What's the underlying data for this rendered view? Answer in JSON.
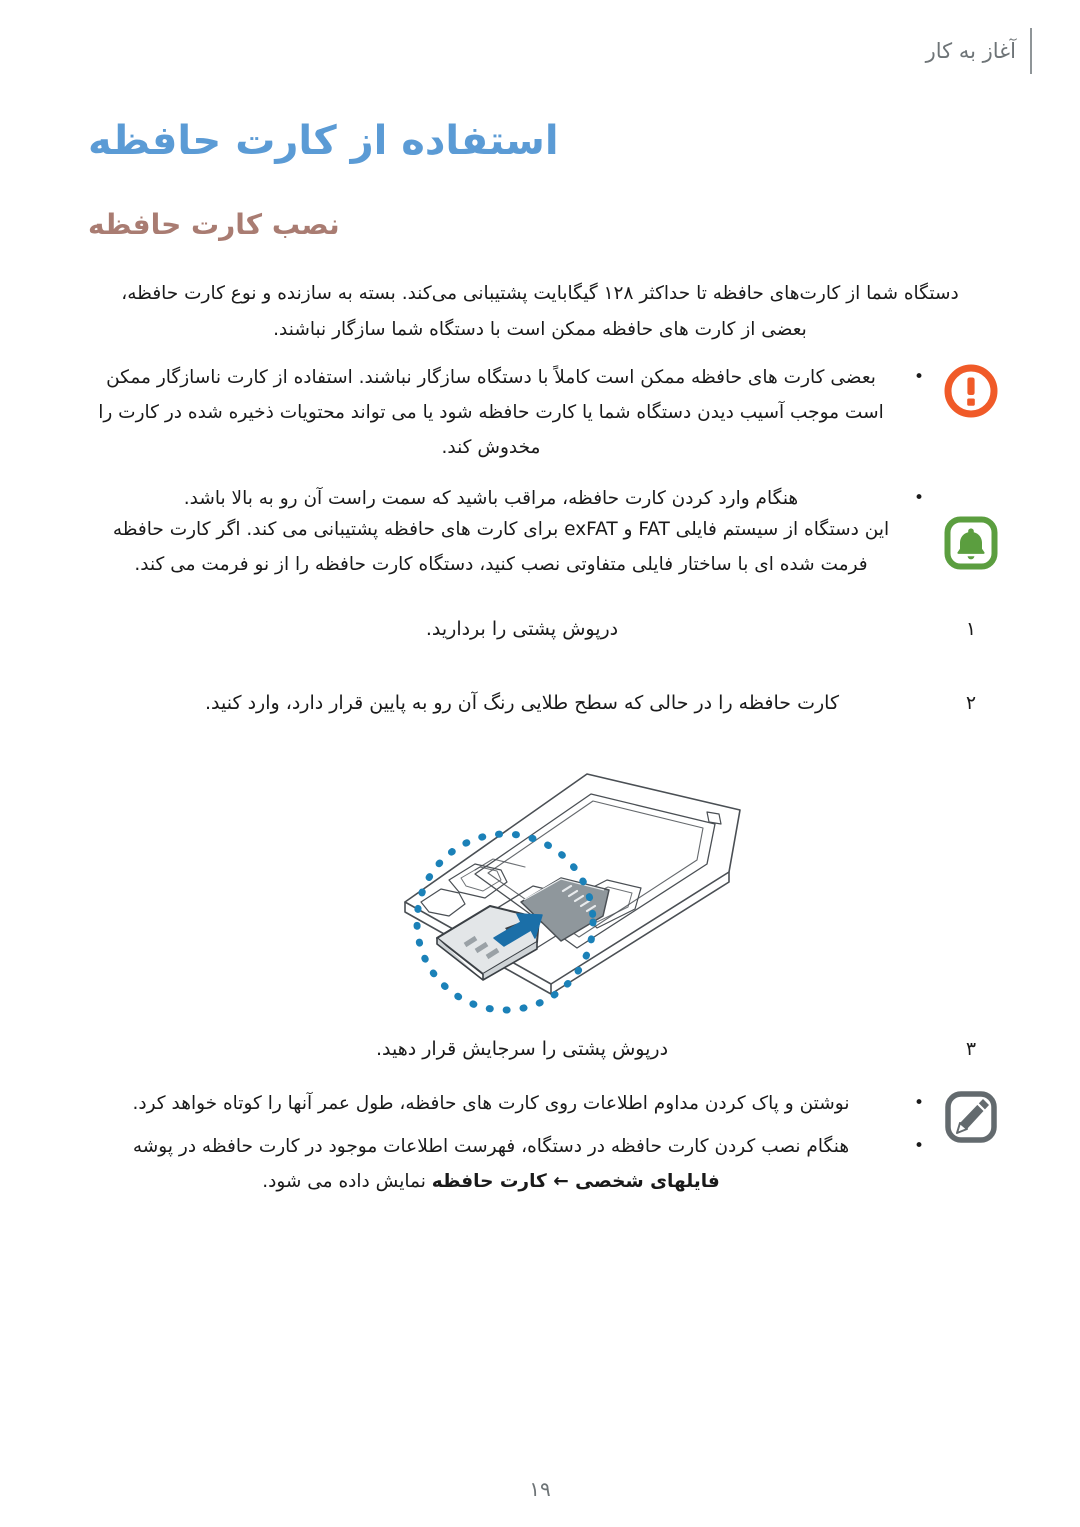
{
  "header": {
    "chapter_label": "آغاز به کار"
  },
  "titles": {
    "chapter": "استفاده از کارت حافظه",
    "section": "نصب کارت حافظه"
  },
  "intro": {
    "line1": "دستگاه شما از کارت‌های حافظه تا حداکثر ۱۲۸ گیگابایت پشتیبانی می‌کند. بسته به سازنده و نوع کارت حافظه،",
    "line2": "بعضی از کارت های حافظه ممکن است با دستگاه شما سازگار نباشند."
  },
  "callouts": [
    {
      "id": "warning",
      "icon": "warning-exclamation-icon",
      "icon_color": "#f05a28",
      "bullets": [
        {
          "lines": [
            "بعضی کارت های حافظه ممکن است کاملاً با دستگاه سازگار نباشند. استفاده از کارت ناسازگار ممکن",
            "است موجب آسیب دیدن دستگاه شما یا کارت حافظه شود یا می تواند محتویات ذخیره شده در کارت را",
            "مخدوش کند."
          ]
        },
        {
          "lines": [
            "هنگام وارد کردن کارت حافظه، مراقب باشید که سمت راست آن رو به بالا باشد."
          ]
        }
      ]
    },
    {
      "id": "note",
      "icon": "bell-icon",
      "icon_color": "#5b9e3f",
      "bullets": [
        {
          "lines": [
            "این دستگاه از سیستم فایلی FAT و exFAT برای کارت های حافظه پشتیبانی می کند. اگر کارت حافظه",
            "فرمت شده ای با ساختار فایلی متفاوتی نصب کنید، دستگاه کارت حافظه را از نو فرمت می کند."
          ]
        }
      ]
    },
    {
      "id": "tip",
      "icon": "pencil-note-icon",
      "icon_color": "#636a6e",
      "bullets": [
        {
          "lines": [
            "نوشتن و پاک کردن مداوم اطلاعات روی کارت های حافظه، طول عمر آنها را کوتاه خواهد کرد."
          ]
        },
        {
          "lines": [
            "هنگام نصب کردن کارت حافظه در دستگاه، فهرست اطلاعات موجود در کارت حافظه در پوشه"
          ],
          "line_bold_prefix": "فایلهای شخصی ← کارت حافظه",
          "line_bold_suffix": " نمایش داده می شود."
        }
      ]
    }
  ],
  "steps": [
    {
      "number": "۱",
      "text": "درپوش پشتی را بردارید."
    },
    {
      "number": "۲",
      "text": "کارت حافظه را در حالی که سطح طلایی رنگ آن رو به پایین قرار دارد، وارد کنید."
    },
    {
      "number": "۳",
      "text": "درپوش پشتی را سرجایش قرار دهید."
    }
  ],
  "illustration": {
    "name": "memory-card-insertion-diagram",
    "highlight_circle_color": "#1b81b8",
    "arrow_color": "#1b6fa8",
    "card_fill": "#8f979c",
    "outline_color": "#4a4f54"
  },
  "footer": {
    "page_number": "۱۹"
  },
  "colors": {
    "chapter_title": "#5b9bd5",
    "section_title": "#a97c72",
    "header_text": "#6e7477",
    "body_text": "#1a1a1a"
  }
}
